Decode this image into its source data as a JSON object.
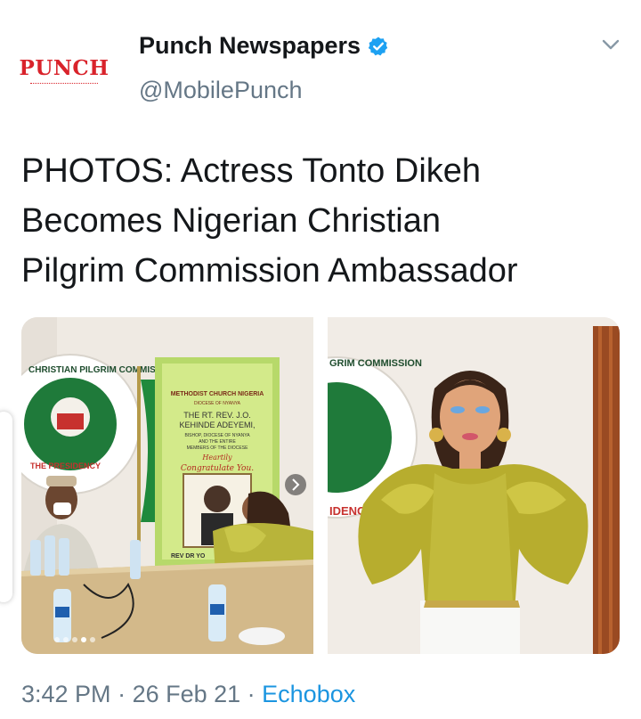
{
  "header": {
    "avatar_logo": "PUNCH",
    "display_name": "Punch Newspapers",
    "handle": "@MobilePunch",
    "verified": true,
    "icons": [
      "verified-badge-icon",
      "chevron-down-icon"
    ]
  },
  "tweet": {
    "line1": "PHOTOS: Actress Tonto Dikeh",
    "line2": "Becomes Nigerian Christian",
    "line3": "Pilgrim Commission Ambassador"
  },
  "media": {
    "photo1": {
      "banner_title": "METHODIST CHURCH NIGERIA",
      "banner_sub": "DIOCESE OF NYANYA",
      "banner_line1": "THE RT. REV. J.O.",
      "banner_line2": "KEHINDE ADEYEMI,",
      "banner_line3": "BISHOP, DIOCESE OF NYANYA",
      "banner_line4": "AND THE ENTIRE",
      "banner_line5": "MEMBERS OF THE DIOCESE",
      "banner_line6": "Heartily",
      "banner_line7": "Congratulate You.",
      "banner_bottom": "REV DR YO",
      "seal_text": "CHRISTIAN PILGRIM COMMISSION",
      "seal_text2": "THE PRESIDENCY"
    },
    "photo2": {
      "seal_text": "GRIM COMMISSION",
      "seal_text2": "IDENCY"
    }
  },
  "meta": {
    "time": "3:42 PM",
    "sep1": " · ",
    "date": "26 Feb 21",
    "sep2": " · ",
    "source": "Echobox"
  },
  "colors": {
    "brand_red": "#d9232b",
    "link_blue": "#1b95e0",
    "secondary_text": "#657786",
    "verified_blue": "#1da1f2"
  }
}
